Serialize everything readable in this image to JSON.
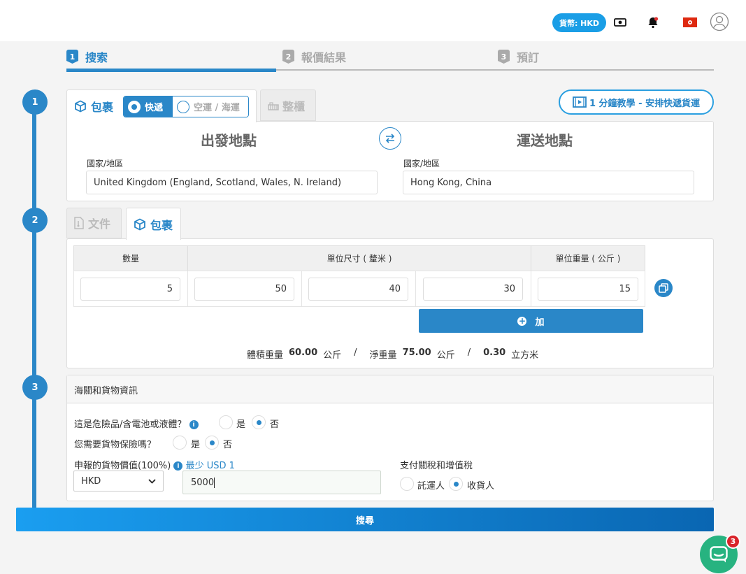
{
  "header": {
    "currency_label": "貨幣: HKD",
    "icons": [
      "cash-icon",
      "bell-icon",
      "hk-flag-icon",
      "user-icon"
    ]
  },
  "steps": [
    {
      "num": "1",
      "label": "搜索"
    },
    {
      "num": "2",
      "label": "報價結果"
    },
    {
      "num": "3",
      "label": "預訂"
    }
  ],
  "timeline": [
    "1",
    "2",
    "3"
  ],
  "section1": {
    "tab_parcel": "包裹",
    "toggle_express": "快遞",
    "toggle_air_sea": "空運 / 海運",
    "tab_container": "整櫃",
    "tutorial_button": "1 分鐘教學 - 安排快遞貨運",
    "origin_title": "出發地點",
    "destination_title": "運送地點",
    "origin_label": "國家/地區",
    "origin_value": "United Kingdom (England, Scotland, Wales, N. Ireland)",
    "destination_label": "國家/地區",
    "destination_value": "Hong Kong, China"
  },
  "section2": {
    "tab_document": "文件",
    "tab_parcel": "包裹",
    "col_quantity": "數量",
    "col_dimensions": "單位尺寸 ( 釐米 )",
    "col_weight": "單位重量 ( 公斤 )",
    "row": {
      "quantity": "5",
      "length": "50",
      "width": "40",
      "height": "30",
      "weight": "15"
    },
    "add_button": "加",
    "summary": {
      "vol_label": "體積重量",
      "vol_value": "60.00",
      "vol_unit": "公斤",
      "sep1": "/",
      "net_label": "淨重量",
      "net_value": "75.00",
      "net_unit": "公斤",
      "sep2": "/",
      "cbm_value": "0.30",
      "cbm_unit": "立方米"
    }
  },
  "section3": {
    "title": "海關和貨物資訊",
    "q_dangerous": "這是危險品/含電池或液體？",
    "q_insurance": "您需要貨物保險嗎？",
    "yes": "是",
    "no": "否",
    "dangerous_selected": "否",
    "insurance_selected": "否",
    "declared_label": "申報的貨物價值(100%)",
    "declared_min": "最少 USD 1",
    "currency_select": "HKD",
    "declared_value": "5000",
    "duty_label": "支付關稅和增值稅",
    "duty_shipper": "託運人",
    "duty_consignee": "收貨人",
    "duty_selected": "收貨人"
  },
  "search_button": "搜尋",
  "chat": {
    "badge": "3"
  }
}
